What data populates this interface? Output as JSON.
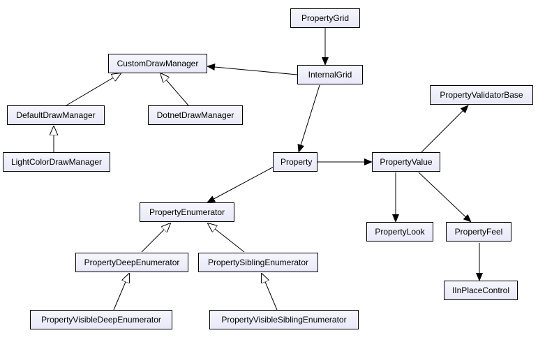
{
  "nodes": {
    "PropertyGrid": "PropertyGrid",
    "CustomDrawManager": "CustomDrawManager",
    "InternalGrid": "InternalGrid",
    "PropertyValidatorBase": "PropertyValidatorBase",
    "DefaultDrawManager": "DefaultDrawManager",
    "DotnetDrawManager": "DotnetDrawManager",
    "LightColorDrawManager": "LightColorDrawManager",
    "Property": "Property",
    "PropertyValue": "PropertyValue",
    "PropertyEnumerator": "PropertyEnumerator",
    "PropertyLook": "PropertyLook",
    "PropertyFeel": "PropertyFeel",
    "PropertyDeepEnumerator": "PropertyDeepEnumerator",
    "PropertySiblingEnumerator": "PropertySiblingEnumerator",
    "IInPlaceControl": "IInPlaceControl",
    "PropertyVisibleDeepEnumerator": "PropertyVisibleDeepEnumerator",
    "PropertyVisibleSiblingEnumerator": "PropertyVisibleSiblingEnumerator"
  },
  "chart_data": {
    "type": "diagram",
    "title": "",
    "nodes": [
      "PropertyGrid",
      "CustomDrawManager",
      "InternalGrid",
      "PropertyValidatorBase",
      "DefaultDrawManager",
      "DotnetDrawManager",
      "LightColorDrawManager",
      "Property",
      "PropertyValue",
      "PropertyEnumerator",
      "PropertyLook",
      "PropertyFeel",
      "PropertyDeepEnumerator",
      "PropertySiblingEnumerator",
      "IInPlaceControl",
      "PropertyVisibleDeepEnumerator",
      "PropertyVisibleSiblingEnumerator"
    ],
    "edges": [
      {
        "from": "PropertyGrid",
        "to": "InternalGrid",
        "type": "association"
      },
      {
        "from": "InternalGrid",
        "to": "CustomDrawManager",
        "type": "association"
      },
      {
        "from": "InternalGrid",
        "to": "Property",
        "type": "association"
      },
      {
        "from": "DefaultDrawManager",
        "to": "CustomDrawManager",
        "type": "inheritance"
      },
      {
        "from": "DotnetDrawManager",
        "to": "CustomDrawManager",
        "type": "inheritance"
      },
      {
        "from": "LightColorDrawManager",
        "to": "DefaultDrawManager",
        "type": "inheritance"
      },
      {
        "from": "Property",
        "to": "PropertyEnumerator",
        "type": "association"
      },
      {
        "from": "Property",
        "to": "PropertyValue",
        "type": "association"
      },
      {
        "from": "PropertyValue",
        "to": "PropertyValidatorBase",
        "type": "association"
      },
      {
        "from": "PropertyValue",
        "to": "PropertyLook",
        "type": "association"
      },
      {
        "from": "PropertyValue",
        "to": "PropertyFeel",
        "type": "association"
      },
      {
        "from": "PropertyFeel",
        "to": "IInPlaceControl",
        "type": "association"
      },
      {
        "from": "PropertyDeepEnumerator",
        "to": "PropertyEnumerator",
        "type": "inheritance"
      },
      {
        "from": "PropertySiblingEnumerator",
        "to": "PropertyEnumerator",
        "type": "inheritance"
      },
      {
        "from": "PropertyVisibleDeepEnumerator",
        "to": "PropertyDeepEnumerator",
        "type": "inheritance"
      },
      {
        "from": "PropertyVisibleSiblingEnumerator",
        "to": "PropertySiblingEnumerator",
        "type": "inheritance"
      }
    ]
  }
}
